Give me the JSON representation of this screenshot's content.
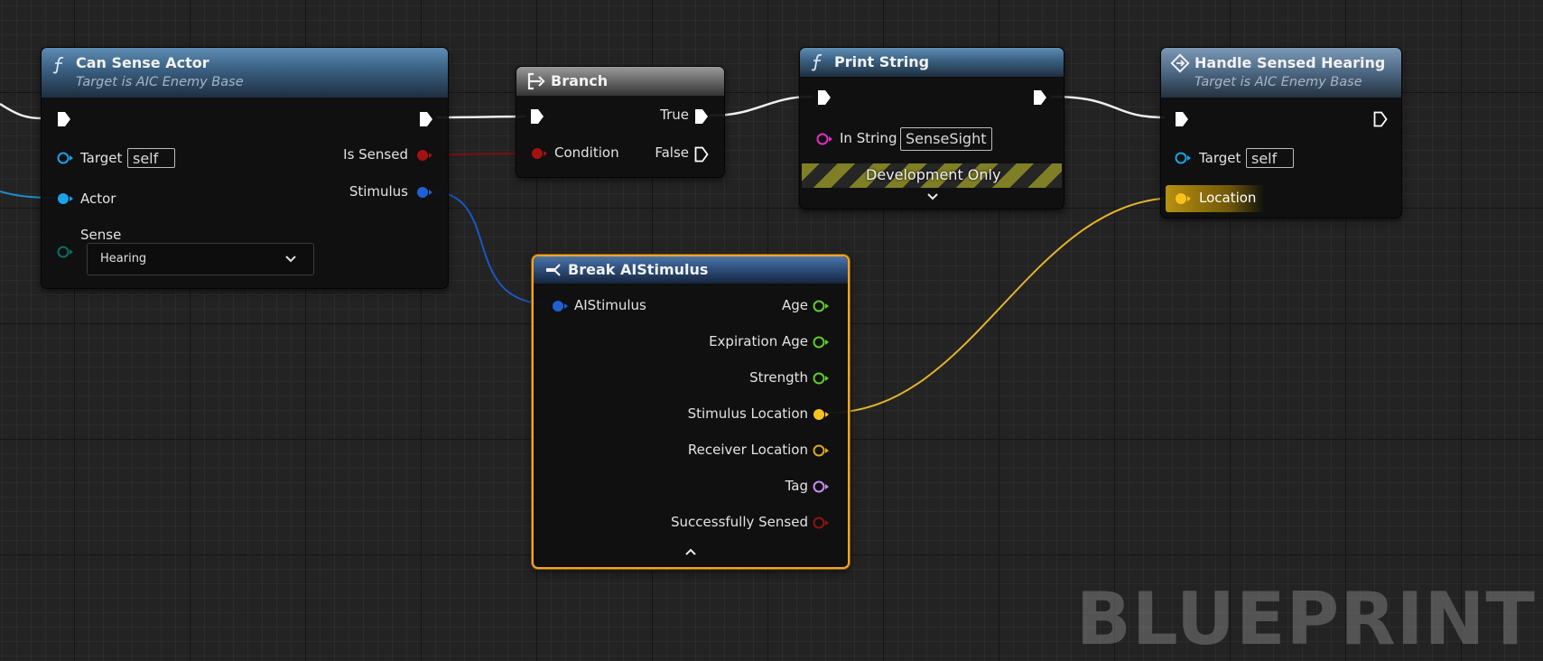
{
  "nodes": {
    "can_sense_actor": {
      "title": "Can Sense Actor",
      "subtitle": "Target is AIC Enemy Base",
      "pins": {
        "target_label": "Target",
        "target_value": "self",
        "actor_label": "Actor",
        "sense_label": "Sense",
        "sense_value": "Hearing",
        "is_sensed_label": "Is Sensed",
        "stimulus_label": "Stimulus"
      }
    },
    "branch": {
      "title": "Branch",
      "pins": {
        "condition_label": "Condition",
        "true_label": "True",
        "false_label": "False"
      }
    },
    "print_string": {
      "title": "Print String",
      "pins": {
        "in_string_label": "In String",
        "in_string_value": "SenseSight"
      },
      "dev_only_label": "Development Only"
    },
    "handle_sensed_hearing": {
      "title": "Handle Sensed Hearing",
      "subtitle": "Target is AIC Enemy Base",
      "pins": {
        "target_label": "Target",
        "target_value": "self",
        "location_label": "Location"
      }
    },
    "break_ai_stimulus": {
      "title": "Break AIStimulus",
      "pins": {
        "input_label": "AIStimulus",
        "outputs": [
          "Age",
          "Expiration Age",
          "Strength",
          "Stimulus Location",
          "Receiver Location",
          "Tag",
          "Successfully Sensed"
        ]
      }
    }
  },
  "watermark": "BLUEPRINT",
  "colors": {
    "exec": "#ffffff",
    "object": "#1aa3e8",
    "bool": "#a31212",
    "struct": "#1f60d4",
    "float": "#5fcc2c",
    "vector": "#f8c21e",
    "string": "#e22ec2",
    "name": "#c88cf0",
    "selection": "#f3a42a"
  },
  "icons": [
    "function-icon",
    "branch-icon",
    "break-struct-icon",
    "event-icon",
    "chevron-down-icon",
    "chevron-up-icon"
  ]
}
